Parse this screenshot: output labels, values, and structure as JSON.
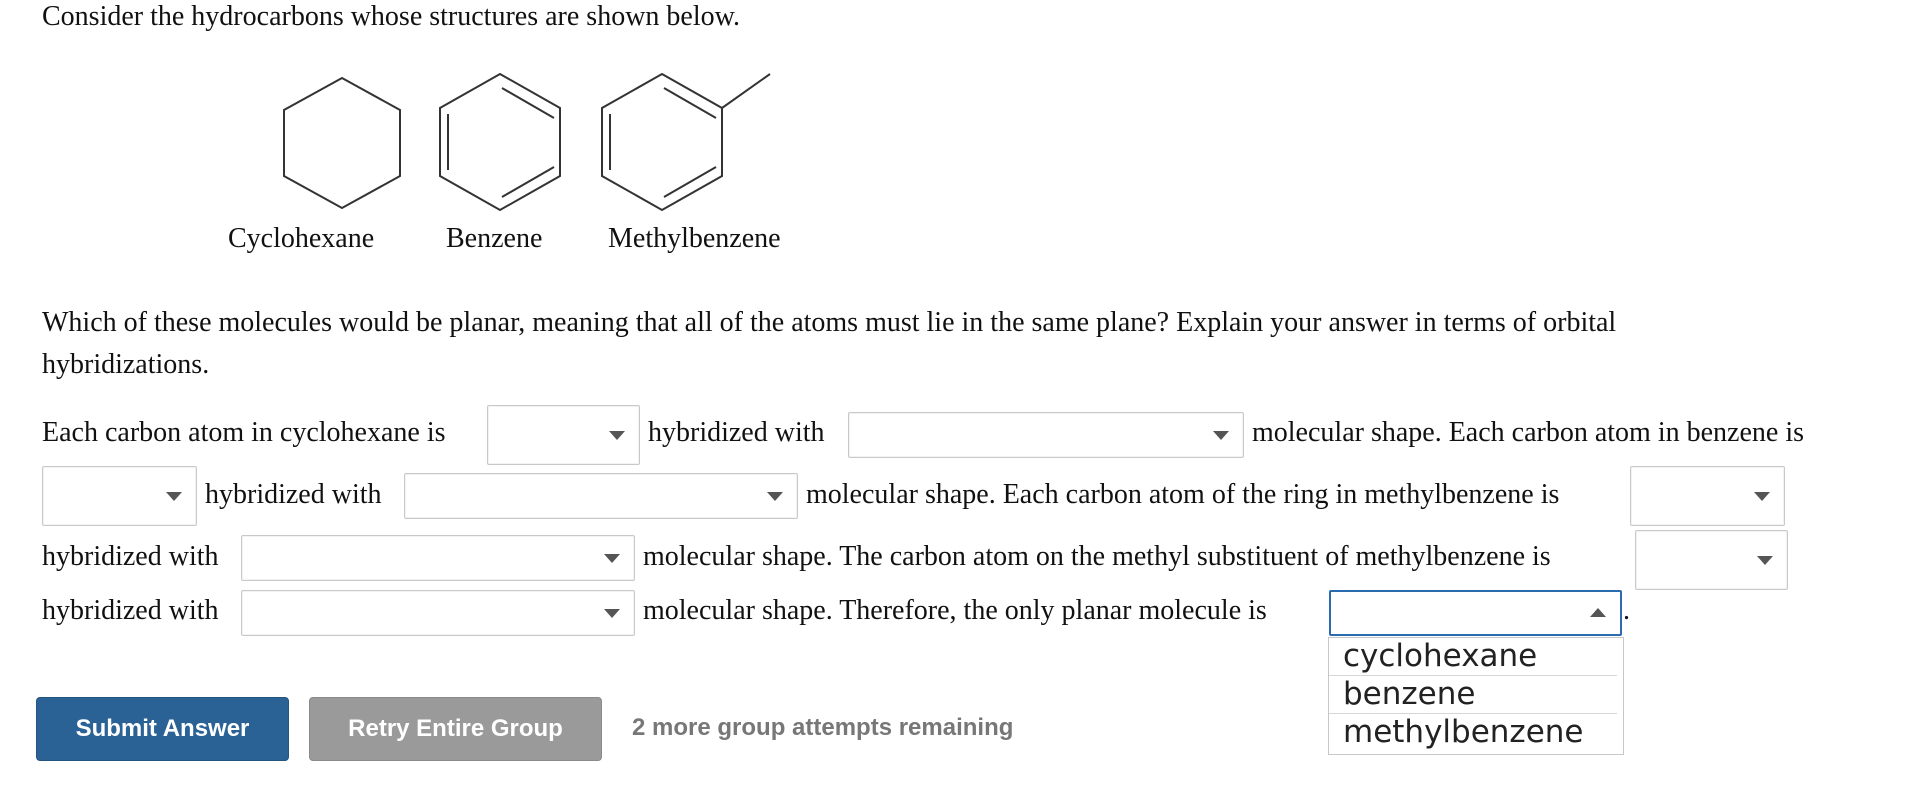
{
  "question": {
    "intro": "Consider the hydrocarbons whose structures are shown below.",
    "molecules": [
      "Cyclohexane",
      "Benzene",
      "Methylbenzene"
    ],
    "prompt": "Which of these molecules would be planar, meaning that all of the atoms must lie in the same plane? Explain your answer in terms of orbital hybridizations."
  },
  "sentence": {
    "s1": "Each carbon atom in cyclohexane is",
    "s2": "hybridized with",
    "s3": "molecular shape. Each carbon atom in benzene is",
    "s4": "hybridized with",
    "s5": "molecular shape. Each carbon atom of the ring in methylbenzene is",
    "s6": "hybridized with",
    "s7": "molecular shape. The carbon atom on the methyl substituent of methylbenzene is",
    "s8": "hybridized with",
    "s9": "molecular shape. Therefore, the only planar molecule is",
    "s10": "."
  },
  "dropdowns": {
    "selected": [
      "",
      "",
      "",
      "",
      "",
      "",
      "",
      "",
      "",
      ""
    ],
    "open_options": [
      "cyclohexane",
      "benzene",
      "methylbenzene"
    ]
  },
  "actions": {
    "submit": "Submit Answer",
    "retry": "Retry Entire Group",
    "attempts": "2 more group attempts remaining"
  }
}
